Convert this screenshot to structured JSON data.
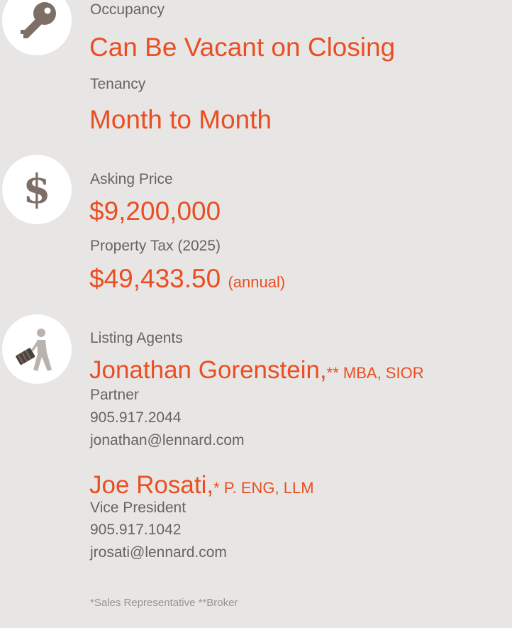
{
  "occupancy": {
    "label": "Occupancy",
    "value": "Can Be Vacant on Closing",
    "icon": "key-icon"
  },
  "tenancy": {
    "label": "Tenancy",
    "value": "Month to Month"
  },
  "price": {
    "label": "Asking Price",
    "value": "$9,200,000",
    "icon": "dollar-icon",
    "symbol": "$"
  },
  "tax": {
    "label": "Property Tax (2025)",
    "value": "$49,433.50",
    "suffix": "(annual)"
  },
  "agents": {
    "label": "Listing Agents",
    "icon": "walking-person-briefcase-icon",
    "list": [
      {
        "name": "Jonathan Gorenstein,",
        "marker": "**",
        "credentials": " MBA, SIOR",
        "title": "Partner",
        "phone": "905.917.2044",
        "email": "jonathan@lennard.com"
      },
      {
        "name": "Joe Rosati,",
        "marker": "*",
        "credentials": " P. ENG, LLM",
        "title": "Vice President",
        "phone": "905.917.1042",
        "email": "jrosati@lennard.com"
      }
    ]
  },
  "footnote": "*Sales Representative **Broker",
  "colors": {
    "accent": "#ea4e22",
    "text": "#6b625d",
    "icon": "#7d6e66",
    "background": "#e8e6e4"
  }
}
